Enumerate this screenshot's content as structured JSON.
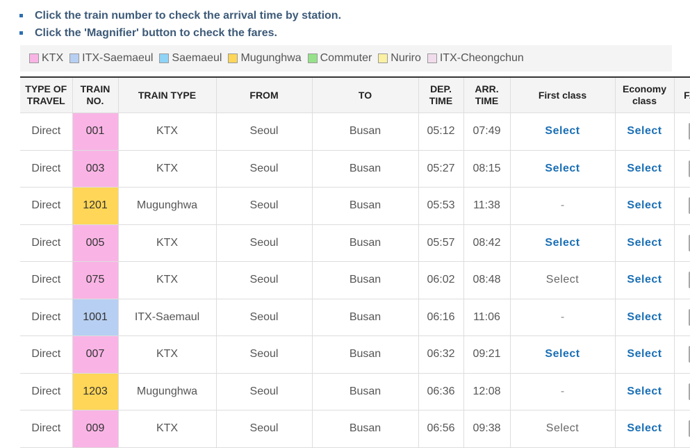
{
  "notes": [
    "Click the train number to check the arrival time by station.",
    "Click the 'Magnifier' button to check the fares."
  ],
  "legend": [
    {
      "label": "KTX",
      "color": "#f9b4e5"
    },
    {
      "label": "ITX-Saemaeul",
      "color": "#b7cff2"
    },
    {
      "label": "Saemaeul",
      "color": "#8fd3f7"
    },
    {
      "label": "Mugunghwa",
      "color": "#ffd657"
    },
    {
      "label": "Commuter",
      "color": "#95e28a"
    },
    {
      "label": "Nuriro",
      "color": "#faf1a3"
    },
    {
      "label": "ITX-Cheongchun",
      "color": "#f1dcec"
    }
  ],
  "headers": {
    "type_line1": "TYPE OF",
    "type_line2": "TRAVEL",
    "no_line1": "TRAIN",
    "no_line2": "NO.",
    "train_type": "TRAIN TYPE",
    "from": "FROM",
    "to": "TO",
    "dep_line1": "DEP.",
    "dep_line2": "TIME",
    "arr_line1": "ARR.",
    "arr_line2": "TIME",
    "first": "First class",
    "eco_line1": "Economy",
    "eco_line2": "class",
    "fare": "FARE"
  },
  "fare_icon": "magnifier-icon",
  "rows": [
    {
      "type": "Direct",
      "no": "001",
      "no_color": "#f9b4e5",
      "train": "KTX",
      "from": "Seoul",
      "to": "Busan",
      "dep": "05:12",
      "arr": "07:49",
      "first": "Select",
      "first_state": "active",
      "eco": "Select"
    },
    {
      "type": "Direct",
      "no": "003",
      "no_color": "#f9b4e5",
      "train": "KTX",
      "from": "Seoul",
      "to": "Busan",
      "dep": "05:27",
      "arr": "08:15",
      "first": "Select",
      "first_state": "active",
      "eco": "Select"
    },
    {
      "type": "Direct",
      "no": "1201",
      "no_color": "#ffd657",
      "train": "Mugunghwa",
      "from": "Seoul",
      "to": "Busan",
      "dep": "05:53",
      "arr": "11:38",
      "first": "-",
      "first_state": "none",
      "eco": "Select"
    },
    {
      "type": "Direct",
      "no": "005",
      "no_color": "#f9b4e5",
      "train": "KTX",
      "from": "Seoul",
      "to": "Busan",
      "dep": "05:57",
      "arr": "08:42",
      "first": "Select",
      "first_state": "active",
      "eco": "Select"
    },
    {
      "type": "Direct",
      "no": "075",
      "no_color": "#f9b4e5",
      "train": "KTX",
      "from": "Seoul",
      "to": "Busan",
      "dep": "06:02",
      "arr": "08:48",
      "first": "Select",
      "first_state": "soldout",
      "eco": "Select"
    },
    {
      "type": "Direct",
      "no": "1001",
      "no_color": "#b7cff2",
      "train": "ITX-Saemaul",
      "from": "Seoul",
      "to": "Busan",
      "dep": "06:16",
      "arr": "11:06",
      "first": "-",
      "first_state": "none",
      "eco": "Select"
    },
    {
      "type": "Direct",
      "no": "007",
      "no_color": "#f9b4e5",
      "train": "KTX",
      "from": "Seoul",
      "to": "Busan",
      "dep": "06:32",
      "arr": "09:21",
      "first": "Select",
      "first_state": "active",
      "eco": "Select"
    },
    {
      "type": "Direct",
      "no": "1203",
      "no_color": "#ffd657",
      "train": "Mugunghwa",
      "from": "Seoul",
      "to": "Busan",
      "dep": "06:36",
      "arr": "12:08",
      "first": "-",
      "first_state": "none",
      "eco": "Select"
    },
    {
      "type": "Direct",
      "no": "009",
      "no_color": "#f9b4e5",
      "train": "KTX",
      "from": "Seoul",
      "to": "Busan",
      "dep": "06:56",
      "arr": "09:38",
      "first": "Select",
      "first_state": "soldout",
      "eco": "Select"
    }
  ]
}
